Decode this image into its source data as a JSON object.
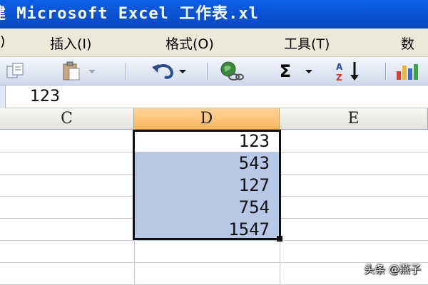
{
  "window": {
    "title": "建 Microsoft Excel 工作表.xl"
  },
  "menubar": {
    "items": [
      {
        "label": ")"
      },
      {
        "label": "插入(I)"
      },
      {
        "label": "格式(O)"
      },
      {
        "label": "工具(T)"
      },
      {
        "label": "数"
      }
    ]
  },
  "toolbar": {
    "sum_symbol": "Σ",
    "icons": [
      "copy-icon",
      "paste-icon",
      "undo-icon",
      "hyperlink-icon",
      "autosum-icon",
      "sort-ascending-icon",
      "chart-icon"
    ]
  },
  "formula_bar": {
    "value": "123"
  },
  "columns": [
    {
      "label": "C"
    },
    {
      "label": "D"
    },
    {
      "label": "E"
    }
  ],
  "column_d_values": [
    "123",
    "543",
    "127",
    "754",
    "1547"
  ],
  "watermark": "头条 @燕子",
  "colors": {
    "titlebar": "#0a5fe8",
    "selection_fill": "#b6c8e6",
    "active_header": "#f7b65e"
  }
}
